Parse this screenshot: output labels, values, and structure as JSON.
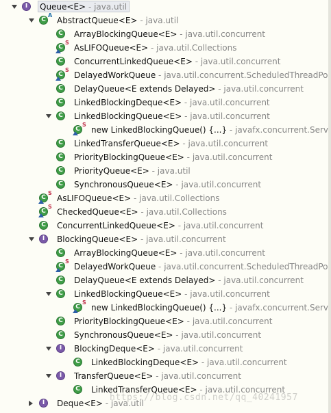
{
  "tree": [
    {
      "depth": 0,
      "twisty": "open",
      "kind": "interface",
      "label": "Queue<E>",
      "package": "java.util",
      "selected": true
    },
    {
      "depth": 1,
      "twisty": "open",
      "kind": "class",
      "abstract": true,
      "label": "AbstractQueue<E>",
      "package": "java.util"
    },
    {
      "depth": 2,
      "kind": "class",
      "label": "ArrayBlockingQueue<E>",
      "package": "java.util.concurrent"
    },
    {
      "depth": 2,
      "kind": "class",
      "static": true,
      "nested": true,
      "label": "AsLIFOQueue<E>",
      "package": "java.util.Collections"
    },
    {
      "depth": 2,
      "kind": "class",
      "label": "ConcurrentLinkedQueue<E>",
      "package": "java.util.concurrent"
    },
    {
      "depth": 2,
      "kind": "class",
      "static": true,
      "nested": true,
      "label": "DelayedWorkQueue",
      "package": "java.util.concurrent.ScheduledThreadPoo"
    },
    {
      "depth": 2,
      "kind": "class",
      "label": "DelayQueue<E extends Delayed>",
      "package": "java.util.concurrent"
    },
    {
      "depth": 2,
      "kind": "class",
      "label": "LinkedBlockingDeque<E>",
      "package": "java.util.concurrent"
    },
    {
      "depth": 2,
      "twisty": "open",
      "kind": "class",
      "label": "LinkedBlockingQueue<E>",
      "package": "java.util.concurrent"
    },
    {
      "depth": 3,
      "kind": "class",
      "static": true,
      "anon": true,
      "label": "new LinkedBlockingQueue() {...}",
      "package": "javafx.concurrent.Service"
    },
    {
      "depth": 2,
      "kind": "class",
      "label": "LinkedTransferQueue<E>",
      "package": "java.util.concurrent"
    },
    {
      "depth": 2,
      "kind": "class",
      "label": "PriorityBlockingQueue<E>",
      "package": "java.util.concurrent"
    },
    {
      "depth": 2,
      "kind": "class",
      "label": "PriorityQueue<E>",
      "package": "java.util"
    },
    {
      "depth": 2,
      "kind": "class",
      "label": "SynchronousQueue<E>",
      "package": "java.util.concurrent"
    },
    {
      "depth": 1,
      "kind": "class",
      "static": true,
      "nested": true,
      "label": "AsLIFOQueue<E>",
      "package": "java.util.Collections"
    },
    {
      "depth": 1,
      "kind": "class",
      "static": true,
      "nested": true,
      "label": "CheckedQueue<E>",
      "package": "java.util.Collections"
    },
    {
      "depth": 1,
      "kind": "class",
      "label": "ConcurrentLinkedQueue<E>",
      "package": "java.util.concurrent"
    },
    {
      "depth": 1,
      "twisty": "open",
      "kind": "interface",
      "label": "BlockingQueue<E>",
      "package": "java.util.concurrent"
    },
    {
      "depth": 2,
      "kind": "class",
      "label": "ArrayBlockingQueue<E>",
      "package": "java.util.concurrent"
    },
    {
      "depth": 2,
      "kind": "class",
      "static": true,
      "nested": true,
      "label": "DelayedWorkQueue",
      "package": "java.util.concurrent.ScheduledThreadPoo"
    },
    {
      "depth": 2,
      "kind": "class",
      "label": "DelayQueue<E extends Delayed>",
      "package": "java.util.concurrent"
    },
    {
      "depth": 2,
      "twisty": "open",
      "kind": "class",
      "label": "LinkedBlockingQueue<E>",
      "package": "java.util.concurrent"
    },
    {
      "depth": 3,
      "kind": "class",
      "static": true,
      "anon": true,
      "label": "new LinkedBlockingQueue() {...}",
      "package": "javafx.concurrent.Service"
    },
    {
      "depth": 2,
      "kind": "class",
      "label": "PriorityBlockingQueue<E>",
      "package": "java.util.concurrent"
    },
    {
      "depth": 2,
      "kind": "class",
      "label": "SynchronousQueue<E>",
      "package": "java.util.concurrent"
    },
    {
      "depth": 2,
      "twisty": "open",
      "kind": "interface",
      "label": "BlockingDeque<E>",
      "package": "java.util.concurrent"
    },
    {
      "depth": 3,
      "kind": "class",
      "label": "LinkedBlockingDeque<E>",
      "package": "java.util.concurrent"
    },
    {
      "depth": 2,
      "twisty": "open",
      "kind": "interface",
      "label": "TransferQueue<E>",
      "package": "java.util.concurrent"
    },
    {
      "depth": 3,
      "kind": "class",
      "label": "LinkedTransferQueue<E>",
      "package": "java.util.concurrent"
    },
    {
      "depth": 1,
      "twisty": "closed",
      "kind": "interface",
      "label": "Deque<E>",
      "package": "java.util"
    }
  ],
  "separator": " - ",
  "overlay_static": "S",
  "overlay_abstract": "A",
  "watermark": "https://blog.csdn.net/qq_40241957",
  "colors": {
    "background": "#fdfdf6",
    "class_icon": "#3f9d47",
    "interface_icon": "#7a5aa8",
    "package_text": "#878787",
    "selection": "#e9ebef"
  }
}
